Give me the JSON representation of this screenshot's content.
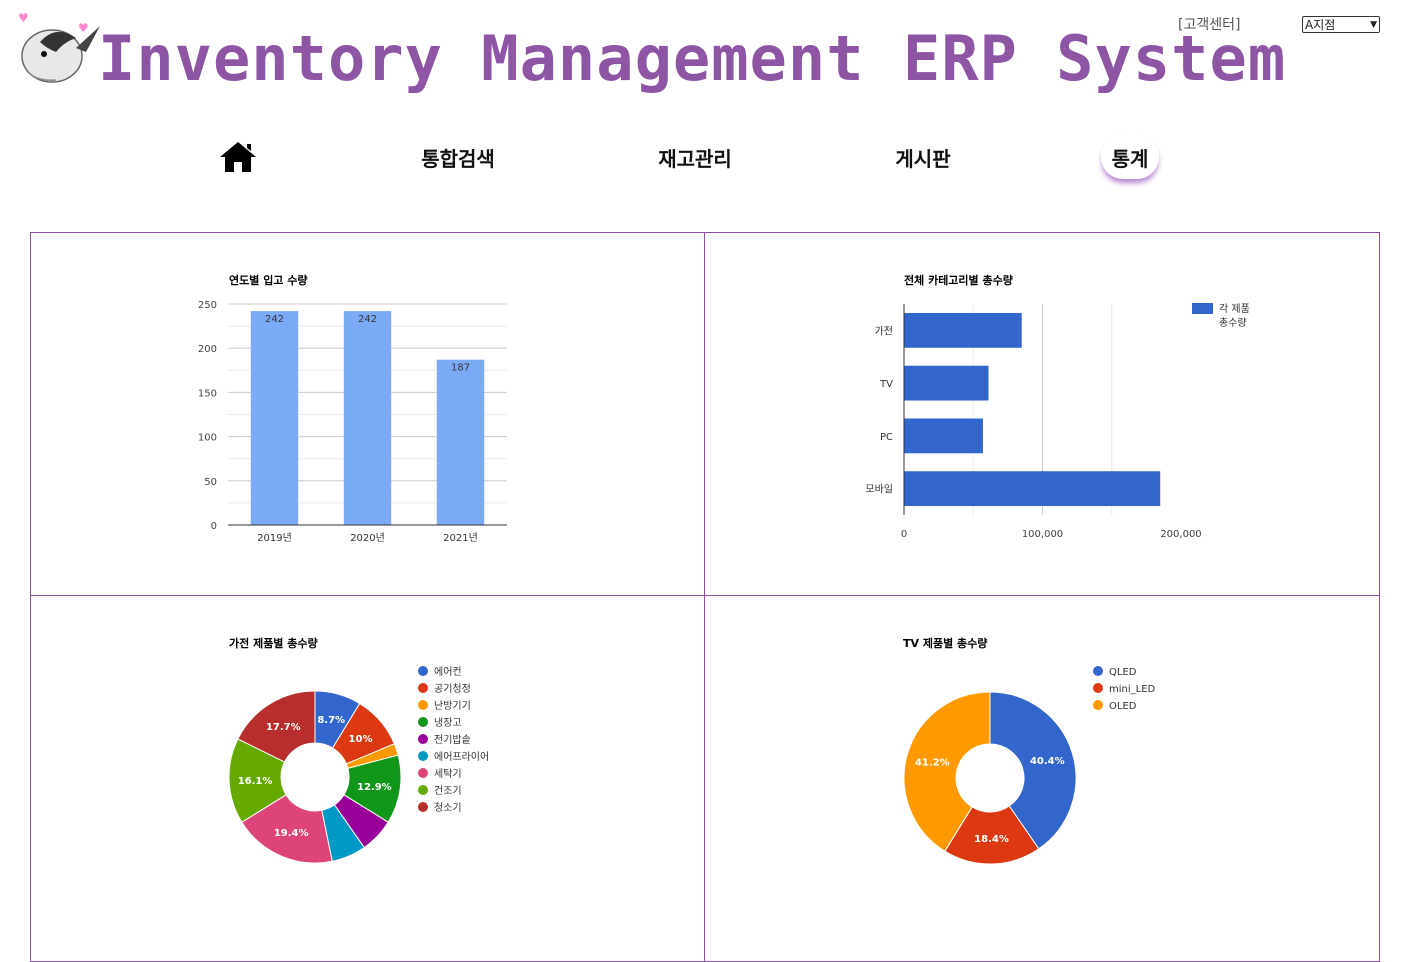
{
  "header": {
    "title": "Inventory Management ERP System",
    "support_link": "[고객센터]",
    "branch_select": "A지점"
  },
  "nav": {
    "home_icon": "home-icon",
    "items": [
      "통합검색",
      "재고관리",
      "게시판",
      "통계"
    ],
    "active": "통계"
  },
  "colors": {
    "brand": "#8e55a5",
    "grid_border": "#8e4da8"
  },
  "chart_data": [
    {
      "type": "bar",
      "title": "연도별 입고 수량",
      "categories": [
        "2019년",
        "2020년",
        "2021년"
      ],
      "values": [
        242,
        242,
        187
      ],
      "data_labels": [
        "242",
        "242",
        "187"
      ],
      "ylim": [
        0,
        250
      ],
      "yticks": [
        "0",
        "50",
        "100",
        "150",
        "200",
        "250"
      ],
      "color": "#7baaf7",
      "grid": true
    },
    {
      "type": "bar",
      "orientation": "horizontal",
      "title": "전체 카테고리별 총수량",
      "categories": [
        "가전",
        "TV",
        "PC",
        "모바일"
      ],
      "values": [
        85000,
        61000,
        57000,
        185000
      ],
      "xlim": [
        0,
        200000
      ],
      "xticks": [
        "0",
        "100,000",
        "200,000"
      ],
      "series": [
        {
          "name": "각 제품 총수량",
          "values": [
            85000,
            61000,
            57000,
            185000
          ]
        }
      ],
      "legend": "right",
      "color": "#3366cc"
    },
    {
      "type": "pie",
      "donut": true,
      "title": "가전 제품별 총수량",
      "legend": "right",
      "slices": [
        {
          "label": "에어컨",
          "value": 8.7,
          "color": "#3366cc",
          "text": "8.7%"
        },
        {
          "label": "공기청정",
          "value": 10.0,
          "color": "#dc3912",
          "text": "10%"
        },
        {
          "label": "난방기기",
          "value": 2.2,
          "color": "#ff9900",
          "text": ""
        },
        {
          "label": "냉장고",
          "value": 12.9,
          "color": "#109618",
          "text": "12.9%"
        },
        {
          "label": "전기밥솥",
          "value": 6.5,
          "color": "#990099",
          "text": ""
        },
        {
          "label": "에어프라이어",
          "value": 6.5,
          "color": "#0099c6",
          "text": ""
        },
        {
          "label": "세탁기",
          "value": 19.4,
          "color": "#dd4477",
          "text": "19.4%"
        },
        {
          "label": "건조기",
          "value": 16.1,
          "color": "#66aa00",
          "text": "16.1%"
        },
        {
          "label": "청소기",
          "value": 17.7,
          "color": "#b82e2e",
          "text": "17.7%"
        }
      ]
    },
    {
      "type": "pie",
      "donut": true,
      "title": "TV 제품별 총수량",
      "legend": "right",
      "slices": [
        {
          "label": "QLED",
          "value": 40.4,
          "color": "#3366cc",
          "text": "40.4%"
        },
        {
          "label": "mini_LED",
          "value": 18.4,
          "color": "#dc3912",
          "text": "18.4%"
        },
        {
          "label": "OLED",
          "value": 41.2,
          "color": "#ff9900",
          "text": "41.2%"
        }
      ]
    }
  ]
}
